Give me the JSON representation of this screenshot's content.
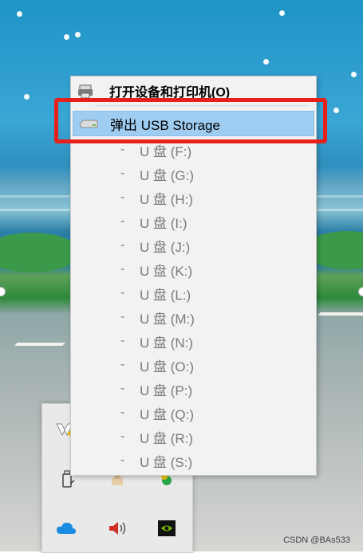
{
  "context_menu": {
    "open_devices": "打开设备和打印机(O)",
    "eject": "弹出 USB Storage",
    "drives": [
      {
        "dash": "-",
        "label": "U 盘 (F:)"
      },
      {
        "dash": "-",
        "label": "U 盘 (G:)"
      },
      {
        "dash": "-",
        "label": "U 盘 (H:)"
      },
      {
        "dash": "-",
        "label": "U 盘 (I:)"
      },
      {
        "dash": "-",
        "label": "U 盘 (J:)"
      },
      {
        "dash": "-",
        "label": "U 盘 (K:)"
      },
      {
        "dash": "-",
        "label": "U 盘 (L:)"
      },
      {
        "dash": "-",
        "label": "U 盘 (M:)"
      },
      {
        "dash": "-",
        "label": "U 盘 (N:)"
      },
      {
        "dash": "-",
        "label": "U 盘 (O:)"
      },
      {
        "dash": "-",
        "label": "U 盘 (P:)"
      },
      {
        "dash": "-",
        "label": "U 盘 (Q:)"
      },
      {
        "dash": "-",
        "label": "U 盘 (R:)"
      },
      {
        "dash": "-",
        "label": "U 盘 (S:)"
      }
    ]
  },
  "tray_icons": [
    "vpn-icon",
    "usb-eject-icon",
    "app-icon",
    "green-ball-icon",
    "onedrive-icon",
    "volume-icon",
    "nvidia-icon"
  ],
  "watermark": "CSDN @BAs533",
  "colors": {
    "highlight": "#9fcdf2",
    "annotation_red": "#e8201a"
  }
}
